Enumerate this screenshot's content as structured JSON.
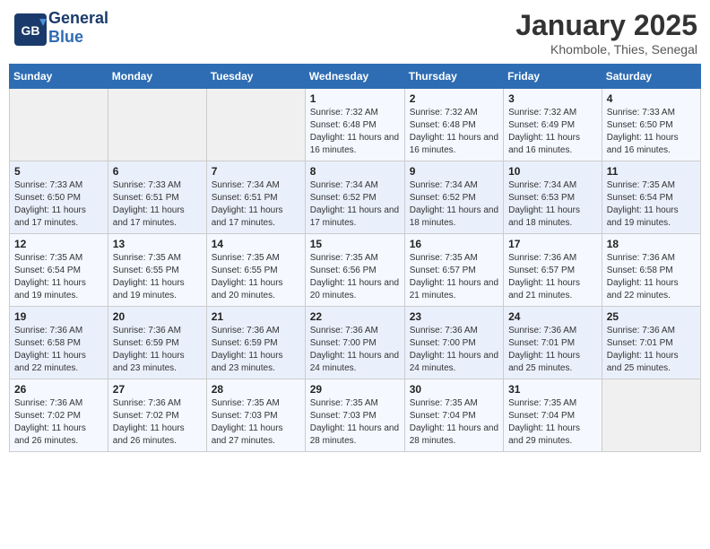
{
  "header": {
    "logo_general": "General",
    "logo_blue": "Blue",
    "title": "January 2025",
    "subtitle": "Khombole, Thies, Senegal"
  },
  "weekdays": [
    "Sunday",
    "Monday",
    "Tuesday",
    "Wednesday",
    "Thursday",
    "Friday",
    "Saturday"
  ],
  "weeks": [
    [
      {
        "day": "",
        "info": ""
      },
      {
        "day": "",
        "info": ""
      },
      {
        "day": "",
        "info": ""
      },
      {
        "day": "1",
        "info": "Sunrise: 7:32 AM\nSunset: 6:48 PM\nDaylight: 11 hours and 16 minutes."
      },
      {
        "day": "2",
        "info": "Sunrise: 7:32 AM\nSunset: 6:48 PM\nDaylight: 11 hours and 16 minutes."
      },
      {
        "day": "3",
        "info": "Sunrise: 7:32 AM\nSunset: 6:49 PM\nDaylight: 11 hours and 16 minutes."
      },
      {
        "day": "4",
        "info": "Sunrise: 7:33 AM\nSunset: 6:50 PM\nDaylight: 11 hours and 16 minutes."
      }
    ],
    [
      {
        "day": "5",
        "info": "Sunrise: 7:33 AM\nSunset: 6:50 PM\nDaylight: 11 hours and 17 minutes."
      },
      {
        "day": "6",
        "info": "Sunrise: 7:33 AM\nSunset: 6:51 PM\nDaylight: 11 hours and 17 minutes."
      },
      {
        "day": "7",
        "info": "Sunrise: 7:34 AM\nSunset: 6:51 PM\nDaylight: 11 hours and 17 minutes."
      },
      {
        "day": "8",
        "info": "Sunrise: 7:34 AM\nSunset: 6:52 PM\nDaylight: 11 hours and 17 minutes."
      },
      {
        "day": "9",
        "info": "Sunrise: 7:34 AM\nSunset: 6:52 PM\nDaylight: 11 hours and 18 minutes."
      },
      {
        "day": "10",
        "info": "Sunrise: 7:34 AM\nSunset: 6:53 PM\nDaylight: 11 hours and 18 minutes."
      },
      {
        "day": "11",
        "info": "Sunrise: 7:35 AM\nSunset: 6:54 PM\nDaylight: 11 hours and 19 minutes."
      }
    ],
    [
      {
        "day": "12",
        "info": "Sunrise: 7:35 AM\nSunset: 6:54 PM\nDaylight: 11 hours and 19 minutes."
      },
      {
        "day": "13",
        "info": "Sunrise: 7:35 AM\nSunset: 6:55 PM\nDaylight: 11 hours and 19 minutes."
      },
      {
        "day": "14",
        "info": "Sunrise: 7:35 AM\nSunset: 6:55 PM\nDaylight: 11 hours and 20 minutes."
      },
      {
        "day": "15",
        "info": "Sunrise: 7:35 AM\nSunset: 6:56 PM\nDaylight: 11 hours and 20 minutes."
      },
      {
        "day": "16",
        "info": "Sunrise: 7:35 AM\nSunset: 6:57 PM\nDaylight: 11 hours and 21 minutes."
      },
      {
        "day": "17",
        "info": "Sunrise: 7:36 AM\nSunset: 6:57 PM\nDaylight: 11 hours and 21 minutes."
      },
      {
        "day": "18",
        "info": "Sunrise: 7:36 AM\nSunset: 6:58 PM\nDaylight: 11 hours and 22 minutes."
      }
    ],
    [
      {
        "day": "19",
        "info": "Sunrise: 7:36 AM\nSunset: 6:58 PM\nDaylight: 11 hours and 22 minutes."
      },
      {
        "day": "20",
        "info": "Sunrise: 7:36 AM\nSunset: 6:59 PM\nDaylight: 11 hours and 23 minutes."
      },
      {
        "day": "21",
        "info": "Sunrise: 7:36 AM\nSunset: 6:59 PM\nDaylight: 11 hours and 23 minutes."
      },
      {
        "day": "22",
        "info": "Sunrise: 7:36 AM\nSunset: 7:00 PM\nDaylight: 11 hours and 24 minutes."
      },
      {
        "day": "23",
        "info": "Sunrise: 7:36 AM\nSunset: 7:00 PM\nDaylight: 11 hours and 24 minutes."
      },
      {
        "day": "24",
        "info": "Sunrise: 7:36 AM\nSunset: 7:01 PM\nDaylight: 11 hours and 25 minutes."
      },
      {
        "day": "25",
        "info": "Sunrise: 7:36 AM\nSunset: 7:01 PM\nDaylight: 11 hours and 25 minutes."
      }
    ],
    [
      {
        "day": "26",
        "info": "Sunrise: 7:36 AM\nSunset: 7:02 PM\nDaylight: 11 hours and 26 minutes."
      },
      {
        "day": "27",
        "info": "Sunrise: 7:36 AM\nSunset: 7:02 PM\nDaylight: 11 hours and 26 minutes."
      },
      {
        "day": "28",
        "info": "Sunrise: 7:35 AM\nSunset: 7:03 PM\nDaylight: 11 hours and 27 minutes."
      },
      {
        "day": "29",
        "info": "Sunrise: 7:35 AM\nSunset: 7:03 PM\nDaylight: 11 hours and 28 minutes."
      },
      {
        "day": "30",
        "info": "Sunrise: 7:35 AM\nSunset: 7:04 PM\nDaylight: 11 hours and 28 minutes."
      },
      {
        "day": "31",
        "info": "Sunrise: 7:35 AM\nSunset: 7:04 PM\nDaylight: 11 hours and 29 minutes."
      },
      {
        "day": "",
        "info": ""
      }
    ]
  ]
}
